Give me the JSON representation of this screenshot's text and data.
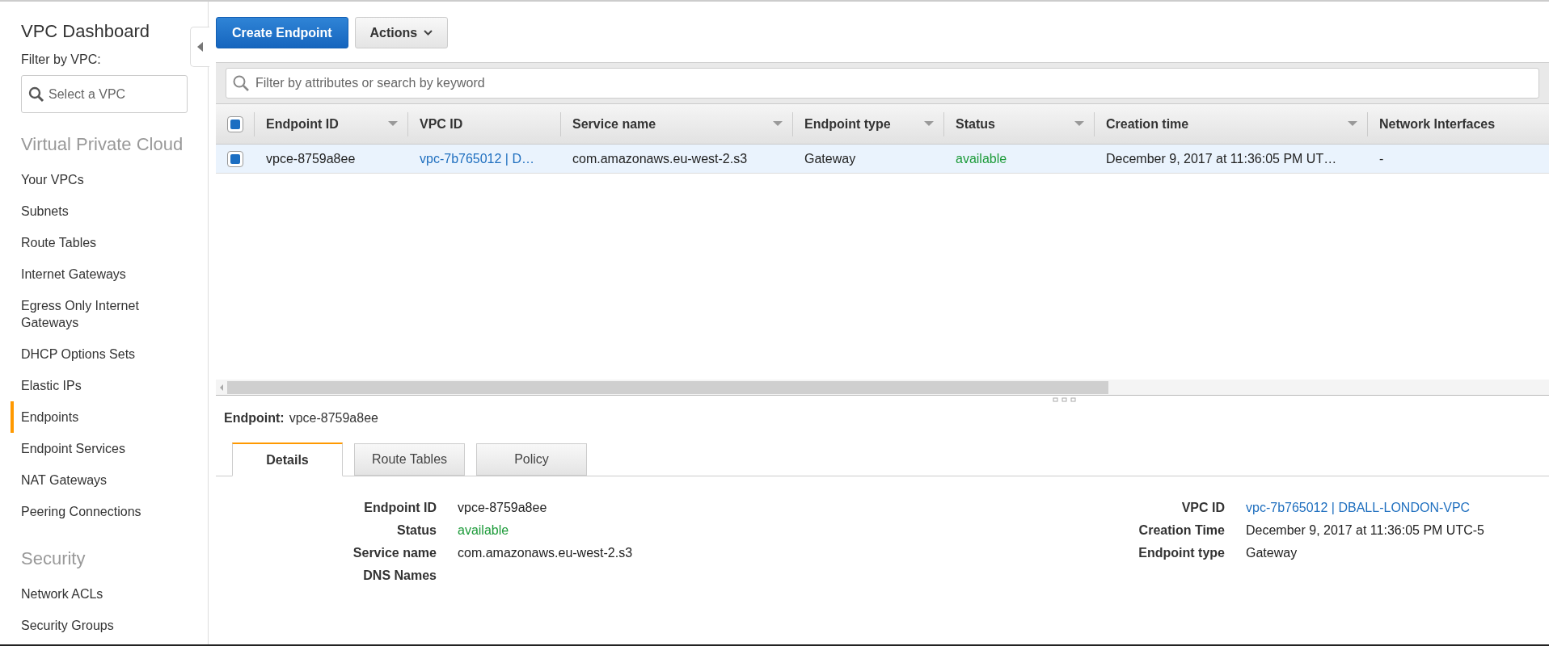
{
  "sidebar": {
    "title": "VPC Dashboard",
    "filter_label": "Filter by VPC:",
    "filter_placeholder": "Select a VPC",
    "sections": [
      {
        "heading": "Virtual Private Cloud",
        "items": [
          {
            "label": "Your VPCs",
            "selected": false
          },
          {
            "label": "Subnets",
            "selected": false
          },
          {
            "label": "Route Tables",
            "selected": false
          },
          {
            "label": "Internet Gateways",
            "selected": false
          },
          {
            "label": "Egress Only Internet Gateways",
            "selected": false
          },
          {
            "label": "DHCP Options Sets",
            "selected": false
          },
          {
            "label": "Elastic IPs",
            "selected": false
          },
          {
            "label": "Endpoints",
            "selected": true
          },
          {
            "label": "Endpoint Services",
            "selected": false
          },
          {
            "label": "NAT Gateways",
            "selected": false
          },
          {
            "label": "Peering Connections",
            "selected": false
          }
        ]
      },
      {
        "heading": "Security",
        "items": [
          {
            "label": "Network ACLs",
            "selected": false
          },
          {
            "label": "Security Groups",
            "selected": false
          }
        ]
      }
    ]
  },
  "toolbar": {
    "create_button": "Create Endpoint",
    "actions_button": "Actions"
  },
  "search": {
    "placeholder": "Filter by attributes or search by keyword"
  },
  "table": {
    "select_all_checked": true,
    "columns": [
      {
        "label": "Endpoint ID",
        "sortable": true
      },
      {
        "label": "VPC ID",
        "sortable": false
      },
      {
        "label": "Service name",
        "sortable": true
      },
      {
        "label": "Endpoint type",
        "sortable": true
      },
      {
        "label": "Status",
        "sortable": true
      },
      {
        "label": "Creation time",
        "sortable": true
      },
      {
        "label": "Network Interfaces",
        "sortable": false
      }
    ],
    "rows": [
      {
        "selected": true,
        "cells": [
          {
            "kind": "text",
            "text": "vpce-8759a8ee"
          },
          {
            "kind": "link",
            "text": "vpc-7b765012 | D…"
          },
          {
            "kind": "text",
            "text": "com.amazonaws.eu-west-2.s3"
          },
          {
            "kind": "text",
            "text": "Gateway"
          },
          {
            "kind": "status",
            "text": "available"
          },
          {
            "kind": "text",
            "text": "December 9, 2017 at 11:36:05 PM UT…"
          },
          {
            "kind": "text",
            "text": "-"
          }
        ]
      }
    ]
  },
  "detail": {
    "label": "Endpoint:",
    "value": "vpce-8759a8ee",
    "tabs": [
      {
        "label": "Details",
        "selected": true
      },
      {
        "label": "Route Tables",
        "selected": false
      },
      {
        "label": "Policy",
        "selected": false
      }
    ],
    "left_fields": [
      {
        "label": "Endpoint ID",
        "kind": "text",
        "value": "vpce-8759a8ee"
      },
      {
        "label": "Status",
        "kind": "status",
        "value": "available"
      },
      {
        "label": "Service name",
        "kind": "text",
        "value": "com.amazonaws.eu-west-2.s3"
      },
      {
        "label": "DNS Names",
        "kind": "text"
      }
    ],
    "right_fields": [
      {
        "label": "VPC ID",
        "kind": "link",
        "value": "vpc-7b765012 | DBALL-LONDON-VPC"
      },
      {
        "label": "Creation Time",
        "kind": "text",
        "value": "December 9, 2017 at 11:36:05 PM UTC-5"
      },
      {
        "label": "Endpoint type",
        "kind": "text",
        "value": "Gateway"
      }
    ]
  }
}
